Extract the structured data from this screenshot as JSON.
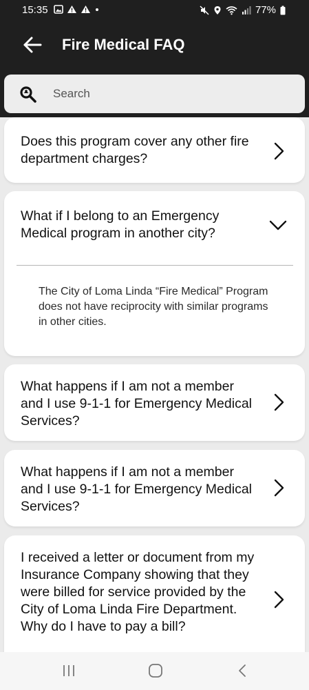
{
  "status_bar": {
    "time": "15:35",
    "battery": "77%"
  },
  "header": {
    "title": "Fire Medical FAQ"
  },
  "search": {
    "placeholder": "Search"
  },
  "faq": [
    {
      "question": "Does this program cover any other fire department charges?",
      "expanded": false
    },
    {
      "question": "What if I belong to an Emergency Medical program in another city?",
      "expanded": true,
      "answer": "The City of Loma Linda “Fire Medical” Program does not have reciprocity with similar programs in other cities."
    },
    {
      "question": "What happens if I am not a member and I use 9-1-1 for Emergency Medical Services?",
      "expanded": false
    },
    {
      "question": "What happens if I am not a member and I use 9-1-1 for Emergency Medical Services?",
      "expanded": false
    },
    {
      "question": "I received a letter or document from my Insurance Company showing that they were billed for service provided by the City of Loma Linda Fire Department. Why do I have to pay a bill?",
      "expanded": false
    }
  ],
  "icons": {
    "back": "arrow-left-icon",
    "search": "search-icon",
    "collapsed": "chevron-right-icon",
    "expanded": "chevron-down-icon",
    "nav": [
      "recent-apps-icon",
      "home-icon",
      "back-nav-icon"
    ]
  },
  "colors": {
    "app_bar": "#1f1f1f",
    "background": "#ebebeb",
    "card": "#ffffff"
  }
}
